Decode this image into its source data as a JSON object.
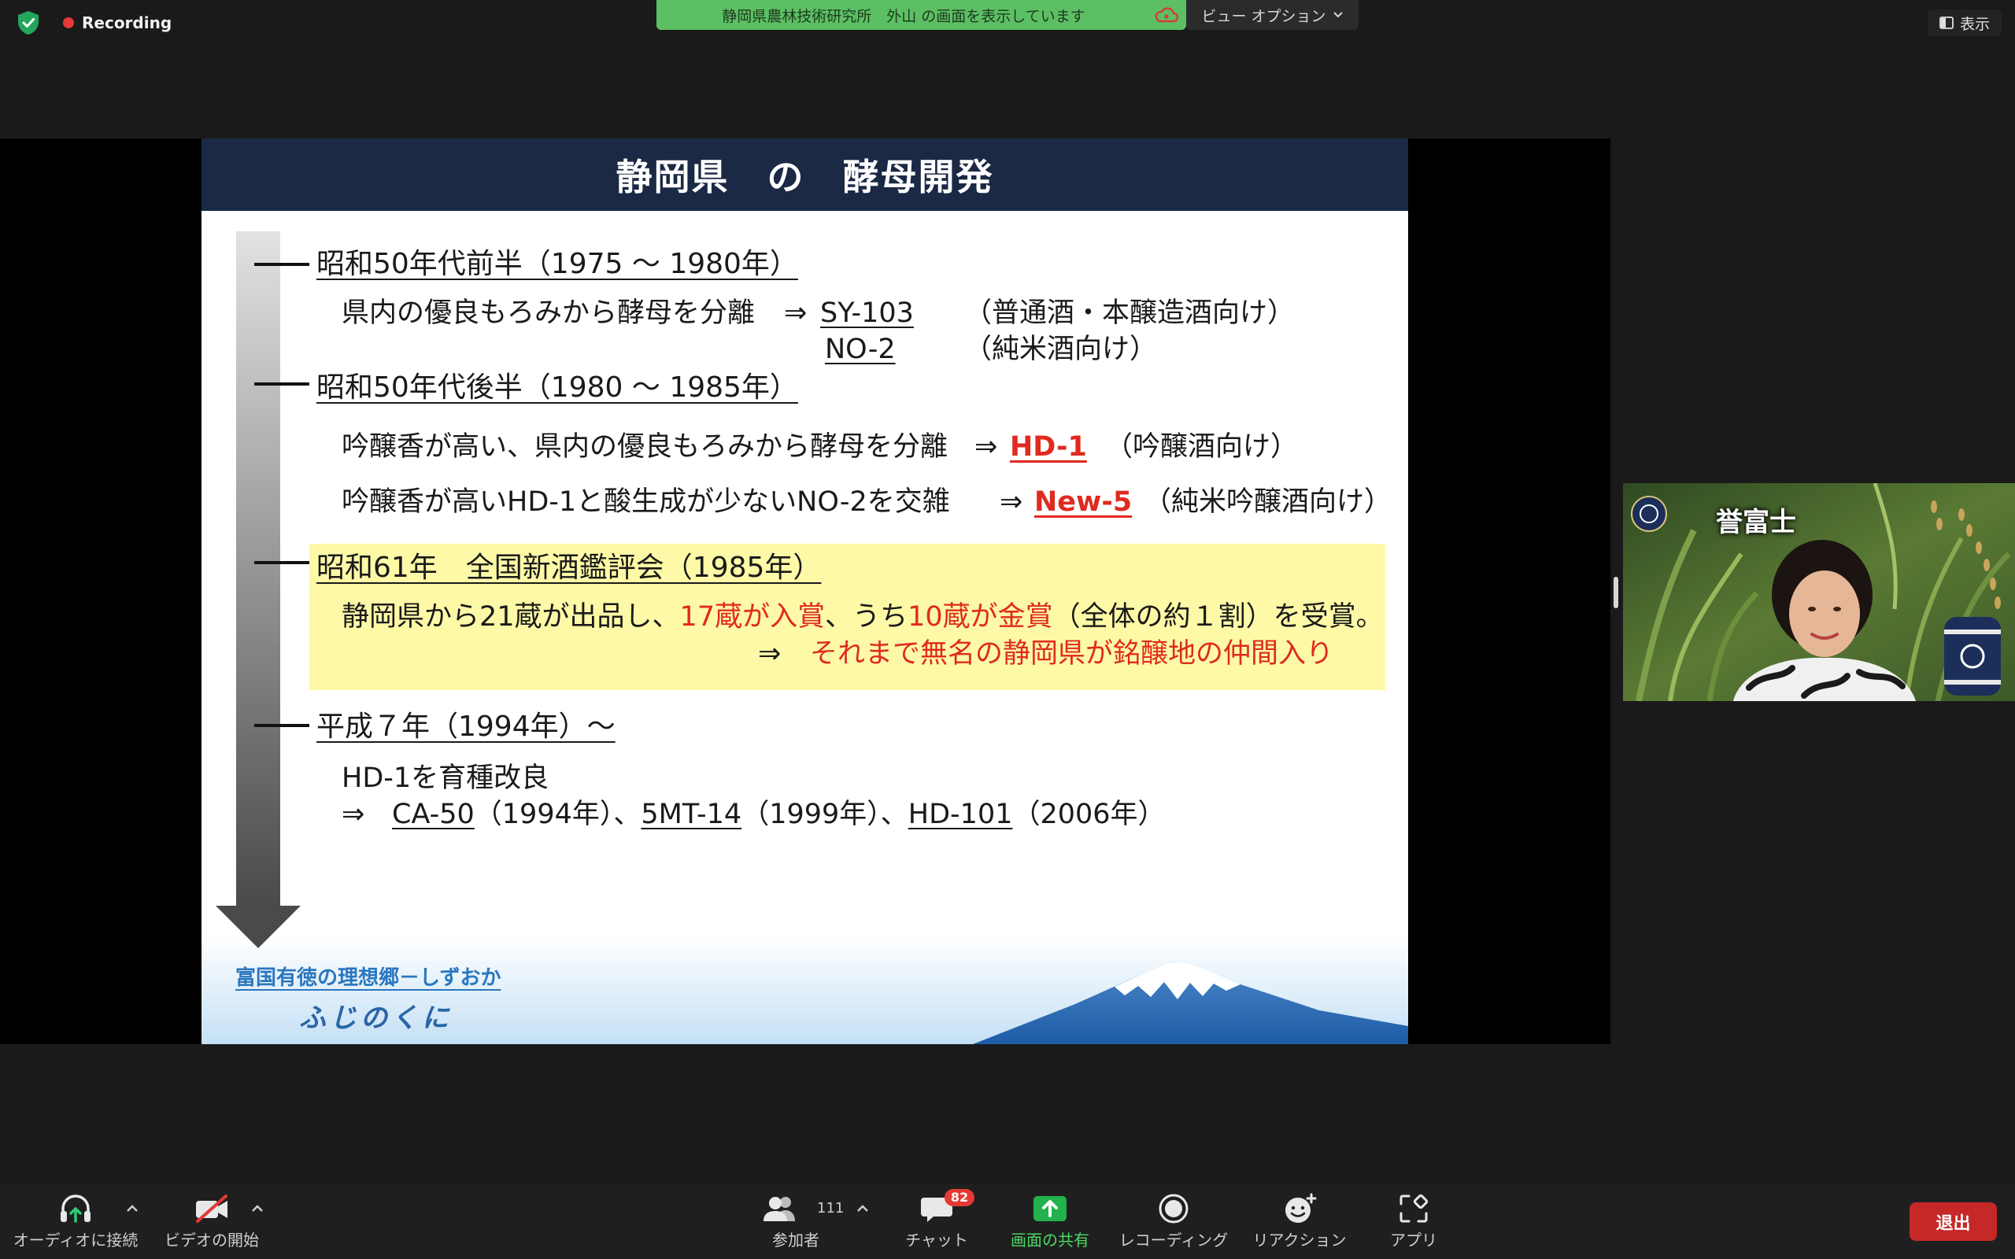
{
  "topbar": {
    "security_icon": "shield-check-icon",
    "recording_label": "Recording",
    "share_banner": "静岡県農林技術研究所　外山 の画面を表示しています",
    "cloud_icon": "cloud-recording-icon",
    "view_options_label": "ビュー オプション",
    "display_label": "表示"
  },
  "slide": {
    "title": "静岡県　の　酵母開発",
    "era1": {
      "heading": "昭和50年代前半（1975 ～ 1980年）",
      "line1": {
        "text": "県内の優良もろみから酵母を分離",
        "arrow": "⇒",
        "strain": "SY-103",
        "note": "（普通酒・本醸造酒向け）"
      },
      "line2": {
        "strain": "NO-2",
        "note": "（純米酒向け）"
      }
    },
    "era2": {
      "heading": "昭和50年代後半（1980 ～ 1985年）",
      "line1": {
        "text": "吟醸香が高い、県内の優良もろみから酵母を分離",
        "arrow": "⇒",
        "strain": "HD-1",
        "note": "（吟醸酒向け）"
      },
      "line2": {
        "text": "吟醸香が高いHD-1と酸生成が少ないNO-2を交雑",
        "arrow": "⇒",
        "strain": "New-5",
        "note": "（純米吟醸酒向け）"
      }
    },
    "era3": {
      "heading": "昭和61年　全国新酒鑑評会（1985年）",
      "line1": {
        "part1": "静岡県から21蔵が出品し、",
        "highlight1": "17蔵が入賞",
        "part2": "、うち",
        "highlight2": "10蔵が金賞",
        "part3": "（全体の約１割）を受賞。"
      },
      "line2": {
        "arrow": "⇒",
        "highlight": "それまで無名の静岡県が銘醸地の仲間入り"
      }
    },
    "era4": {
      "heading": "平成７年（1994年）～",
      "line1": "HD-1を育種改良",
      "line2": {
        "arrow": "⇒",
        "separator": "、",
        "items": [
          {
            "strain": "CA-50",
            "year": "（1994年）"
          },
          {
            "strain": "5MT-14",
            "year": "（1999年）"
          },
          {
            "strain": "HD-101",
            "year": "（2006年）"
          }
        ]
      }
    },
    "footer": {
      "slogan": "富国有徳の理想郷－しずおか",
      "brand": "ふじのくに"
    }
  },
  "video_tile": {
    "overlay_text": "誉富士"
  },
  "toolbar": {
    "audio": {
      "label": "オーディオに接続",
      "icon": "headphones-icon"
    },
    "video": {
      "label": "ビデオの開始",
      "icon": "video-off-icon"
    },
    "participants": {
      "label": "参加者",
      "icon": "participants-icon",
      "count": "111"
    },
    "chat": {
      "label": "チャット",
      "icon": "chat-icon",
      "badge": "82"
    },
    "share": {
      "label": "画面の共有",
      "icon": "share-screen-icon"
    },
    "record": {
      "label": "レコーディング",
      "icon": "record-icon"
    },
    "reactions": {
      "label": "リアクション",
      "icon": "reaction-icon"
    },
    "apps": {
      "label": "アプリ",
      "icon": "apps-icon"
    },
    "leave": {
      "label": "退出"
    }
  },
  "colors": {
    "share_banner": "#5cbf63",
    "slide_header": "#1b2945",
    "highlight_yellow": "#fdf9a6",
    "slide_red": "#e02a20",
    "badge_red": "#e53935",
    "leave_red": "#c62828",
    "share_green": "#4cd964"
  }
}
